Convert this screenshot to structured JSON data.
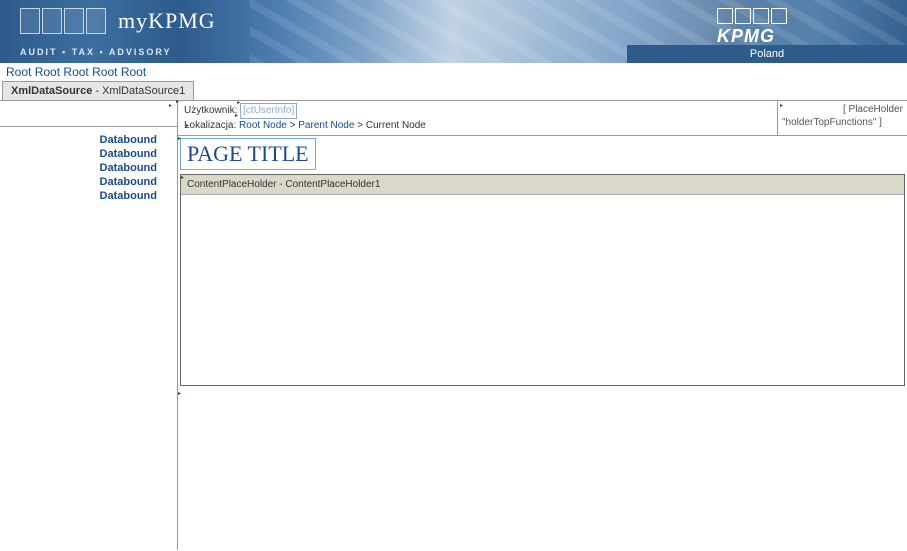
{
  "header": {
    "brand": "myKPMG",
    "tagline": "AUDIT ▪ TAX ▪ ADVISORY",
    "corp_logo_text": "KPMG",
    "country": "Poland"
  },
  "top_menu": {
    "items": [
      "Root",
      "Root",
      "Root",
      "Root",
      "Root"
    ]
  },
  "datasource_tab": {
    "bold": "XmlDataSource",
    "suffix": " - XmlDataSource1"
  },
  "sidebar": {
    "items": [
      "Databound",
      "Databound",
      "Databound",
      "Databound",
      "Databound"
    ]
  },
  "info": {
    "user_label": "Użytkownik:",
    "user_control": "[ctUserInfo]",
    "loc_label": "Lokalizacja:",
    "breadcrumb": {
      "root": "Root Node",
      "parent": "Parent Node",
      "current": "Current Node",
      "sep": ">"
    },
    "placeholder_right_line1": "[ PlaceHolder",
    "placeholder_right_line2": "\"holderTopFunctions\" ]"
  },
  "page": {
    "title": "PAGE TITLE",
    "cph_label": "ContentPlaceHolder - ContentPlaceHolder1"
  },
  "glyphs": {
    "smart_tag": "▸"
  }
}
